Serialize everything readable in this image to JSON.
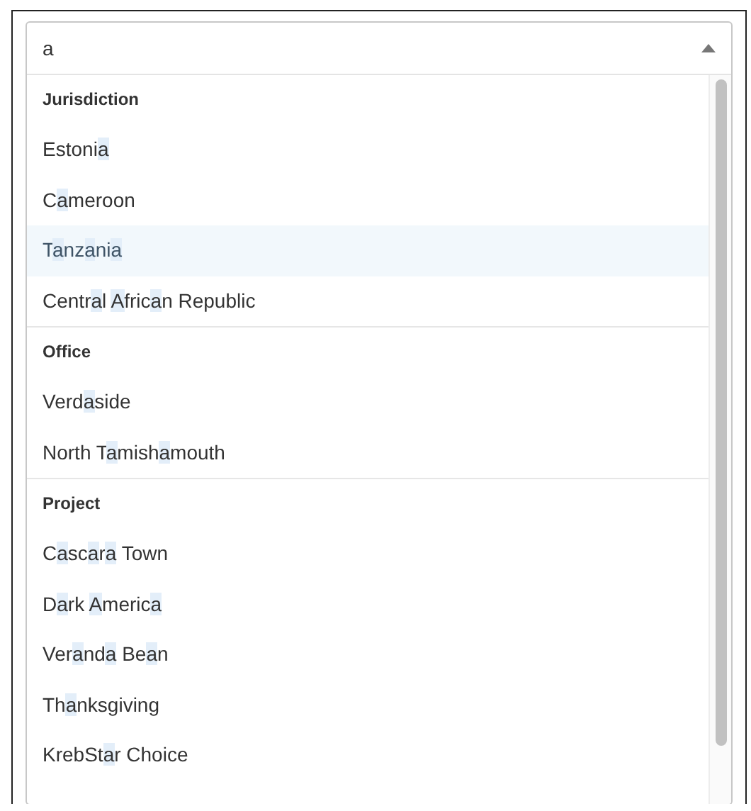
{
  "search": {
    "value": "a",
    "expanded": true
  },
  "groups": [
    {
      "label": "Jurisdiction",
      "options": [
        {
          "highlighted": false,
          "segments": [
            {
              "text": "Eston",
              "match": false
            },
            {
              "text": "i",
              "match": false
            },
            {
              "text": "a",
              "match": true
            }
          ]
        },
        {
          "highlighted": false,
          "segments": [
            {
              "text": "C",
              "match": false
            },
            {
              "text": "a",
              "match": true
            },
            {
              "text": "meroon",
              "match": false
            }
          ]
        },
        {
          "highlighted": true,
          "segments": [
            {
              "text": "T",
              "match": false
            },
            {
              "text": "a",
              "match": true
            },
            {
              "text": "nz",
              "match": false
            },
            {
              "text": "a",
              "match": true
            },
            {
              "text": "ni",
              "match": false
            },
            {
              "text": "a",
              "match": true
            }
          ]
        },
        {
          "highlighted": false,
          "segments": [
            {
              "text": "Centr",
              "match": false
            },
            {
              "text": "a",
              "match": true
            },
            {
              "text": "l ",
              "match": false
            },
            {
              "text": "A",
              "match": true
            },
            {
              "text": "fric",
              "match": false
            },
            {
              "text": "a",
              "match": true
            },
            {
              "text": "n Republic",
              "match": false
            }
          ]
        }
      ]
    },
    {
      "label": "Office",
      "options": [
        {
          "highlighted": false,
          "segments": [
            {
              "text": "Verd",
              "match": false
            },
            {
              "text": "a",
              "match": true
            },
            {
              "text": "side",
              "match": false
            }
          ]
        },
        {
          "highlighted": false,
          "segments": [
            {
              "text": "North T",
              "match": false
            },
            {
              "text": "a",
              "match": true
            },
            {
              "text": "mish",
              "match": false
            },
            {
              "text": "a",
              "match": true
            },
            {
              "text": "mouth",
              "match": false
            }
          ]
        }
      ]
    },
    {
      "label": "Project",
      "options": [
        {
          "highlighted": false,
          "segments": [
            {
              "text": "C",
              "match": false
            },
            {
              "text": "a",
              "match": true
            },
            {
              "text": "sc",
              "match": false
            },
            {
              "text": "a",
              "match": true
            },
            {
              "text": "r",
              "match": false
            },
            {
              "text": "a",
              "match": true
            },
            {
              "text": " Town",
              "match": false
            }
          ]
        },
        {
          "highlighted": false,
          "segments": [
            {
              "text": "D",
              "match": false
            },
            {
              "text": "a",
              "match": true
            },
            {
              "text": "rk ",
              "match": false
            },
            {
              "text": "A",
              "match": true
            },
            {
              "text": "meric",
              "match": false
            },
            {
              "text": "a",
              "match": true
            }
          ]
        },
        {
          "highlighted": false,
          "segments": [
            {
              "text": "Ver",
              "match": false
            },
            {
              "text": "a",
              "match": true
            },
            {
              "text": "nd",
              "match": false
            },
            {
              "text": "a",
              "match": true
            },
            {
              "text": " Be",
              "match": false
            },
            {
              "text": "a",
              "match": true
            },
            {
              "text": "n",
              "match": false
            }
          ]
        },
        {
          "highlighted": false,
          "segments": [
            {
              "text": "Th",
              "match": false
            },
            {
              "text": "a",
              "match": true
            },
            {
              "text": "nksgiving",
              "match": false
            }
          ]
        },
        {
          "highlighted": false,
          "segments": [
            {
              "text": "KrebSt",
              "match": false
            },
            {
              "text": "a",
              "match": true
            },
            {
              "text": "r Choice",
              "match": false
            }
          ]
        }
      ]
    }
  ]
}
